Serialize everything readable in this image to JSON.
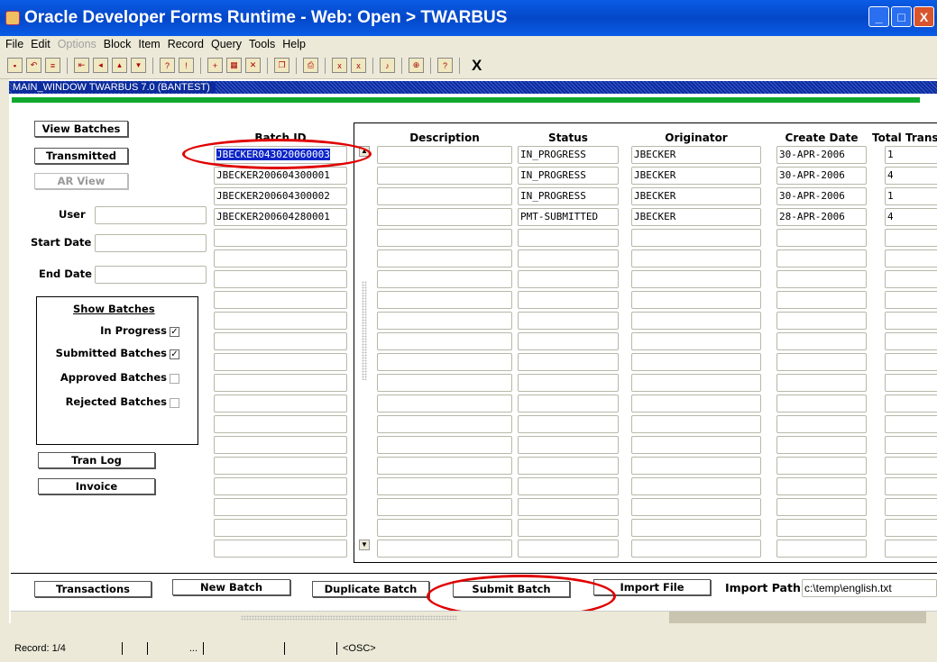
{
  "window": {
    "title": "Oracle Developer Forms Runtime - Web:  Open > TWARBUS",
    "min": "_",
    "max": "□",
    "close": "X"
  },
  "menu": [
    "File",
    "Edit",
    "Options",
    "Block",
    "Item",
    "Record",
    "Query",
    "Tools",
    "Help"
  ],
  "toolbar": {
    "exit": "X"
  },
  "form": {
    "window_label": "MAIN_WINDOW  TWARBUS  7.0  (BANTEST)"
  },
  "left": {
    "view_batches": "View Batches",
    "transmitted": "Transmitted",
    "ar_view": "AR View",
    "user_label": "User",
    "start_date_label": "Start Date",
    "end_date_label": "End Date",
    "show_batches_title": "Show Batches",
    "filters": [
      {
        "label": "In Progress",
        "checked": true
      },
      {
        "label": "Submitted Batches",
        "checked": true
      },
      {
        "label": "Approved Batches",
        "checked": false
      },
      {
        "label": "Rejected Batches",
        "checked": false
      }
    ],
    "tran_log": "Tran Log",
    "invoice": "Invoice"
  },
  "grid": {
    "headers": [
      "Batch ID",
      "Description",
      "Status",
      "Originator",
      "Create Date",
      "Total Trans"
    ],
    "rows": [
      [
        "JBECKER043020060003",
        "",
        "IN_PROGRESS",
        "JBECKER",
        "30-APR-2006",
        "1"
      ],
      [
        "JBECKER200604300001",
        "",
        "IN_PROGRESS",
        "JBECKER",
        "30-APR-2006",
        "4"
      ],
      [
        "JBECKER200604300002",
        "",
        "IN_PROGRESS",
        "JBECKER",
        "30-APR-2006",
        "1"
      ],
      [
        "JBECKER200604280001",
        "",
        "PMT-SUBMITTED",
        "JBECKER",
        "28-APR-2006",
        "4"
      ]
    ],
    "total_rows": 20
  },
  "bottom": {
    "transactions": "Transactions",
    "new_batch": "New Batch",
    "duplicate_batch": "Duplicate Batch",
    "submit_batch": "Submit Batch",
    "import_file": "Import File",
    "import_path_label": "Import Path",
    "import_path_value": "c:\\temp\\english.txt"
  },
  "status": {
    "record": "Record: 1/4",
    "ellipsis": "...",
    "osc": "<OSC>"
  },
  "colors": {
    "title_blue": "#0a5ce6",
    "highlight": "#e00000",
    "green_bar": "#11a82e"
  }
}
